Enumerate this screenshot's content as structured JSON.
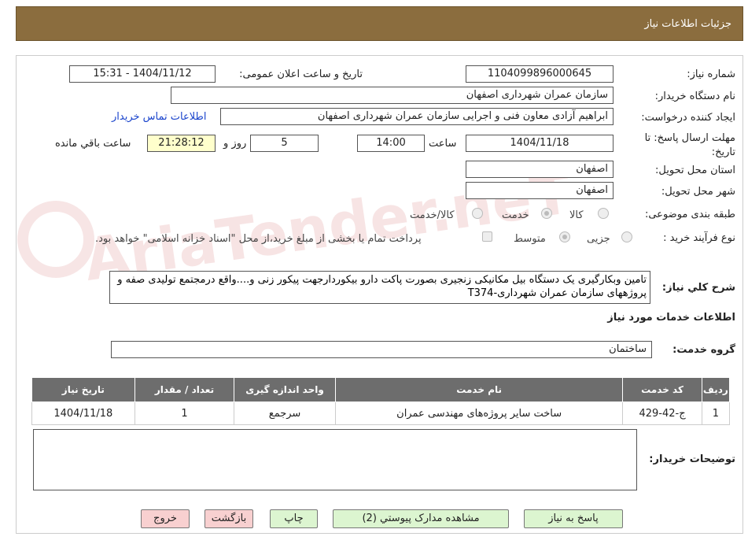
{
  "header": {
    "title": "جزئیات اطلاعات نیاز"
  },
  "form": {
    "need_number": {
      "label": "شماره نیاز:",
      "value": "1104099896000645"
    },
    "announce": {
      "label": "تاریخ و ساعت اعلان عمومی:",
      "value": "1404/11/12 - 15:31"
    },
    "buyer_org": {
      "label": "نام دستگاه خریدار:",
      "value": "سازمان عمران شهرداری اصفهان"
    },
    "requester": {
      "label": "ایجاد کننده درخواست:",
      "value": "ابراهیم آزادی معاون فنی و اجرایی سازمان عمران شهرداری اصفهان",
      "contact_link": "اطلاعات تماس خریدار"
    },
    "deadline": {
      "label": "مهلت ارسال پاسخ: تا تاریخ:",
      "date": "1404/11/18",
      "time_label": "ساعت",
      "time": "14:00",
      "days": "5",
      "days_label": "روز و",
      "remaining": "21:28:12",
      "remaining_label": "ساعت باقي مانده"
    },
    "province": {
      "label": "استان محل تحویل:",
      "value": "اصفهان"
    },
    "city": {
      "label": "شهر محل تحویل:",
      "value": "اصفهان"
    },
    "category": {
      "label": "طبقه بندی موضوعی:",
      "options": [
        "کالا",
        "خدمت",
        "کالا/خدمت"
      ],
      "selected": "خدمت"
    },
    "process": {
      "label": "نوع فرآیند خرید :",
      "options": [
        "جزیی",
        "متوسط"
      ],
      "selected": "متوسط",
      "note": "پرداخت تمام یا بخشی از مبلغ خرید،از محل \"اسناد خزانه اسلامی\" خواهد بود."
    },
    "description": {
      "label": "شرح کلي نياز:",
      "value": "تامین وبکارگیری یک دستگاه بیل مکانیکی زنجیری بصورت پاکت دارو بیکوردارجهت پیکور زنی و....واقع درمجتمع تولیدی صفه و پروژههای سازمان عمران شهرداری-T374"
    }
  },
  "services": {
    "heading": "اطلاعات خدمات مورد نیاز",
    "group_label": "گروه خدمت:",
    "group_value": "ساختمان",
    "columns": [
      "ردیف",
      "کد خدمت",
      "نام خدمت",
      "واحد اندازه گیری",
      "تعداد / مقدار",
      "تاریخ نیاز"
    ],
    "rows": [
      {
        "row": "1",
        "code": "ج-42-429",
        "name": "ساخت سایر پروژه‌های مهندسی عمران",
        "unit": "سرجمع",
        "qty": "1",
        "date": "1404/11/18"
      }
    ]
  },
  "notes_label": "توضیحات خریدار:",
  "buttons": {
    "reply": "پاسخ به نیاز",
    "docs": "مشاهده مدارک پیوستي (2)",
    "print": "چاپ",
    "back": "بازگشت",
    "exit": "خروج"
  },
  "watermark": "AriaTender.neT",
  "colors": {
    "header_bg": "#8B6D3E",
    "table_header": "#6d6d6d",
    "green_button": "#dcf5d0",
    "red_button": "#f8d0d0",
    "yellow_box": "#FFFFCC"
  }
}
